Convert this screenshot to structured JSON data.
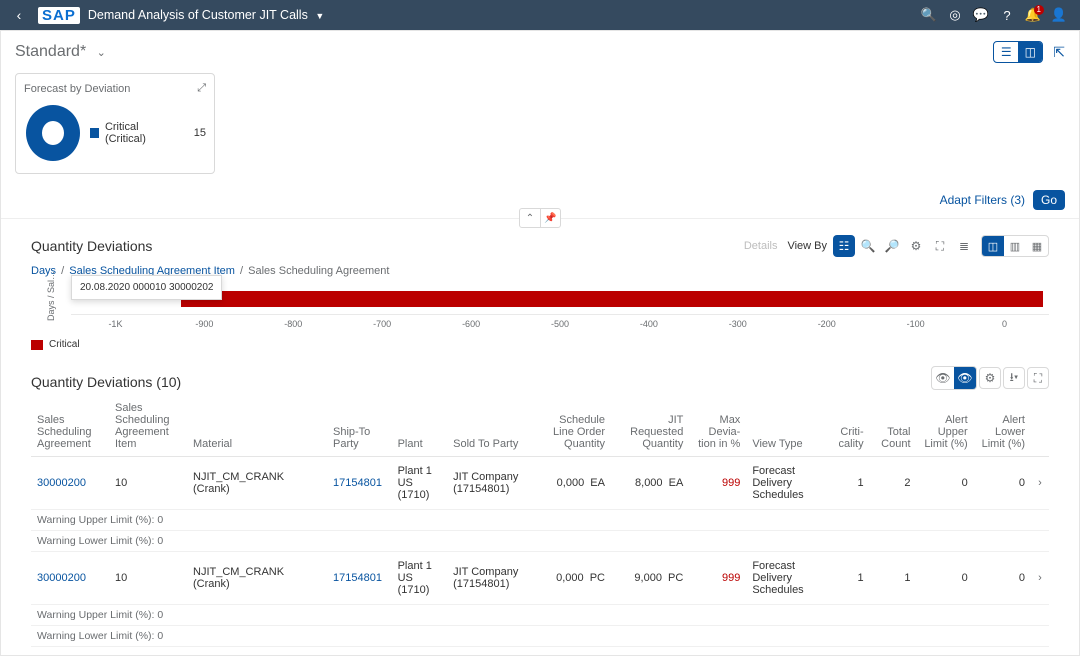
{
  "shell": {
    "app_title": "Demand Analysis of Customer JIT Calls",
    "notif_badge": "1"
  },
  "variant": {
    "name": "Standard",
    "dirty": "*"
  },
  "forecast_card": {
    "title": "Forecast by Deviation",
    "legend_label": "Critical (Critical)",
    "legend_value": "15"
  },
  "filters": {
    "adapt_label": "Adapt Filters (3)",
    "go": "Go"
  },
  "section1": {
    "title": "Quantity Deviations",
    "details": "Details",
    "view_by": "View By"
  },
  "breadcrumb": {
    "a": "Days",
    "b": "Sales Scheduling Agreement Item",
    "c": "Sales Scheduling Agreement"
  },
  "chart_data": {
    "type": "bar",
    "orientation": "horizontal",
    "ylabel": "Days / Sal…",
    "tooltip": "20.08.2020   000010   30000202",
    "categories": [
      "-1K",
      "-900",
      "-800",
      "-700",
      "-600",
      "-500",
      "-400",
      "-300",
      "-200",
      "-100",
      "0"
    ],
    "series": [
      {
        "name": "Critical",
        "value_approx": -999,
        "color": "#bb0000"
      }
    ],
    "legend": "Critical"
  },
  "table": {
    "title": "Quantity Deviations (10)",
    "columns": {
      "c1": "Sales Scheduling Agreement",
      "c2": "Sales Scheduling Agreement Item",
      "c3": "Material",
      "c4": "Ship-To Party",
      "c5": "Plant",
      "c6": "Sold To Party",
      "c7": "Schedule Line Order Quantity",
      "c8": "JIT Requested Quantity",
      "c9": "Max Devia­tion in %",
      "c10": "View Type",
      "c11": "Criti­cality",
      "c12": "Total Count",
      "c13": "Alert Upper Limit (%)",
      "c14": "Alert Lower Limit (%)"
    },
    "rows": [
      {
        "agreement": "30000200",
        "item": "10",
        "material": "NJIT_CM_CRANK (Crank)",
        "ship_to": "17154801",
        "plant": "Plant 1 US (1710)",
        "sold_to": "JIT Company (17154801)",
        "sched_qty": "0,000",
        "sched_uom": "EA",
        "jit_qty": "8,000",
        "jit_uom": "EA",
        "max_dev": "999",
        "view_type": "Forecast Delivery Schedules",
        "criticality": "1",
        "total_count": "2",
        "upper": "0",
        "lower": "0",
        "warn_upper": "Warning Upper Limit (%):  0",
        "warn_lower": "Warning Lower Limit (%):  0"
      },
      {
        "agreement": "30000200",
        "item": "10",
        "material": "NJIT_CM_CRANK (Crank)",
        "ship_to": "17154801",
        "plant": "Plant 1 US (1710)",
        "sold_to": "JIT Company (17154801)",
        "sched_qty": "0,000",
        "sched_uom": "PC",
        "jit_qty": "9,000",
        "jit_uom": "PC",
        "max_dev": "999",
        "view_type": "Forecast Delivery Schedules",
        "criticality": "1",
        "total_count": "1",
        "upper": "0",
        "lower": "0",
        "warn_upper": "Warning Upper Limit (%):  0",
        "warn_lower": "Warning Lower Limit (%):  0"
      }
    ]
  }
}
